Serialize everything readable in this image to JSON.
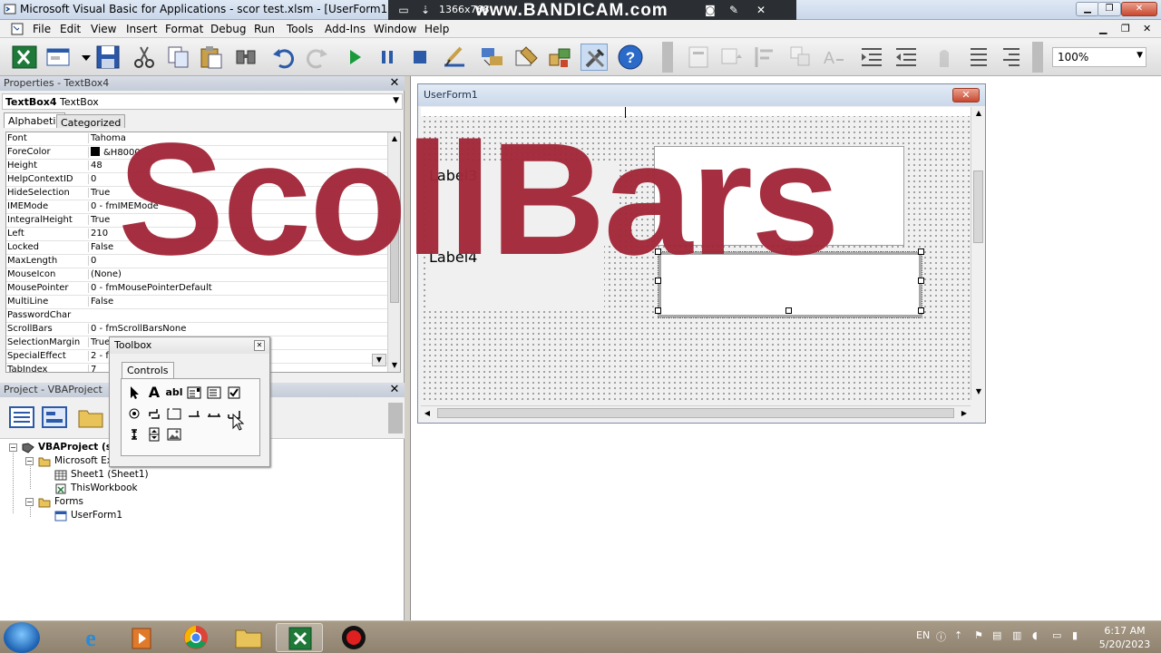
{
  "titlebar": {
    "title": "Microsoft Visual Basic for Applications - scor test.xlsm - [UserForm1 (UserForm)]",
    "recorder_resolution": "1366x768",
    "recorder_brand": "www.BANDICAM.com"
  },
  "menu": {
    "items": [
      "File",
      "Edit",
      "View",
      "Insert",
      "Format",
      "Debug",
      "Run",
      "Tools",
      "Add-Ins",
      "Window",
      "Help"
    ]
  },
  "toolbar": {
    "zoom": "100%",
    "icons": [
      "excel-view-icon",
      "insert-userform-icon",
      "save-icon",
      "cut-icon",
      "copy-icon",
      "paste-icon",
      "find-icon",
      "undo-icon",
      "redo-icon",
      "run-icon",
      "break-icon",
      "reset-icon",
      "design-mode-icon",
      "project-explorer-icon",
      "properties-window-icon",
      "object-browser-icon",
      "toolbox-icon",
      "help-icon"
    ]
  },
  "properties": {
    "pane_title": "Properties - TextBox4",
    "object_name": "TextBox4",
    "object_type": "TextBox",
    "tabs": [
      "Alphabetic",
      "Categorized"
    ],
    "rows": [
      {
        "name": "Font",
        "value": "Tahoma"
      },
      {
        "name": "ForeColor",
        "value": "&H8000"
      },
      {
        "name": "Height",
        "value": "48"
      },
      {
        "name": "HelpContextID",
        "value": "0"
      },
      {
        "name": "HideSelection",
        "value": "True"
      },
      {
        "name": "IMEMode",
        "value": "0 - fmIMEMode"
      },
      {
        "name": "IntegralHeight",
        "value": "True"
      },
      {
        "name": "Left",
        "value": "210"
      },
      {
        "name": "Locked",
        "value": "False"
      },
      {
        "name": "MaxLength",
        "value": "0"
      },
      {
        "name": "MouseIcon",
        "value": "(None)"
      },
      {
        "name": "MousePointer",
        "value": "0 - fmMousePointerDefault"
      },
      {
        "name": "MultiLine",
        "value": "False"
      },
      {
        "name": "PasswordChar",
        "value": ""
      },
      {
        "name": "ScrollBars",
        "value": "0 - fmScrollBarsNone"
      },
      {
        "name": "SelectionMargin",
        "value": "True"
      },
      {
        "name": "SpecialEffect",
        "value": "2 - fm"
      },
      {
        "name": "TabIndex",
        "value": "7"
      }
    ],
    "forecolor_swatch": "#000000"
  },
  "project": {
    "pane_title": "Project - VBAProject",
    "tree": {
      "root": "VBAProject (sc",
      "excel_objects": "Microsoft Exc",
      "sheet1": "Sheet1 (Sheet1)",
      "workbook": "ThisWorkbook",
      "forms": "Forms",
      "userform": "UserForm1"
    }
  },
  "toolbox": {
    "title": "Toolbox",
    "tab": "Controls",
    "controls_row1": [
      "pointer-icon",
      "label-icon",
      "textbox-icon",
      "combobox-icon",
      "listbox-icon",
      "checkbox-icon"
    ],
    "controls_row2": [
      "optionbutton-icon",
      "togglebutton-icon",
      "frame-icon",
      "commandbutton-icon",
      "tabstrip-icon",
      "multipage-icon"
    ],
    "controls_row3": [
      "scrollbar-icon",
      "spinbutton-icon",
      "image-icon"
    ],
    "label_glyph": "A",
    "textbox_glyph": "abl"
  },
  "userform": {
    "title": "UserForm1",
    "label1": "Label3",
    "label2": "Label4"
  },
  "watermark": "ScollBars",
  "taskbar": {
    "language": "EN",
    "time": "6:17 AM",
    "date": "5/20/2023",
    "apps": [
      "internet-explorer-icon",
      "media-player-icon",
      "chrome-icon",
      "file-explorer-icon",
      "excel-icon",
      "bandicam-record-icon"
    ]
  },
  "colors": {
    "watermark": "#a3293a",
    "title_gradient": "#cbd8ea",
    "form_close": "#c8492f"
  }
}
